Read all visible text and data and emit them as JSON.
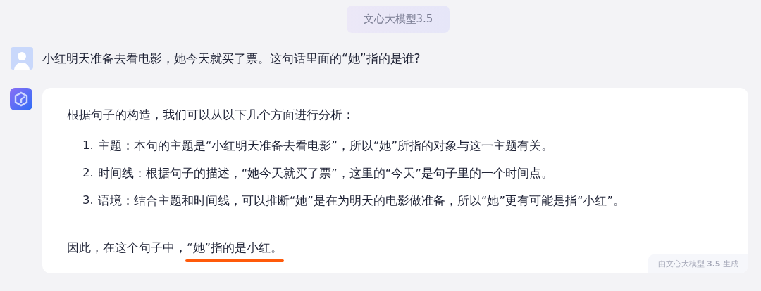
{
  "model_badge": "文心大模型3.5",
  "user_message": {
    "text": "小红明天准备去看电影，她今天就买了票。这句话里面的“她”指的是谁?"
  },
  "reply": {
    "intro": "根据句子的构造，我们可以从以下几个方面进行分析：",
    "points": [
      {
        "number": "1.",
        "text": "主题：本句的主题是“小红明天准备去看电影”，所以“她”所指的对象与这一主题有关。"
      },
      {
        "number": "2.",
        "text": "时间线：根据句子的描述，“她今天就买了票”，这里的“今天”是句子里的一个时间点。"
      },
      {
        "number": "3.",
        "text": "语境：结合主题和时间线，可以推断“她”是在为明天的电影做准备，所以“她”更有可能是指“小红”。"
      }
    ],
    "conclusion": {
      "text": "因此，在这个句子中，",
      "underlined": "“她”指的是小红。"
    },
    "footer": "由文心大模型 **3.5** 生成"
  }
}
